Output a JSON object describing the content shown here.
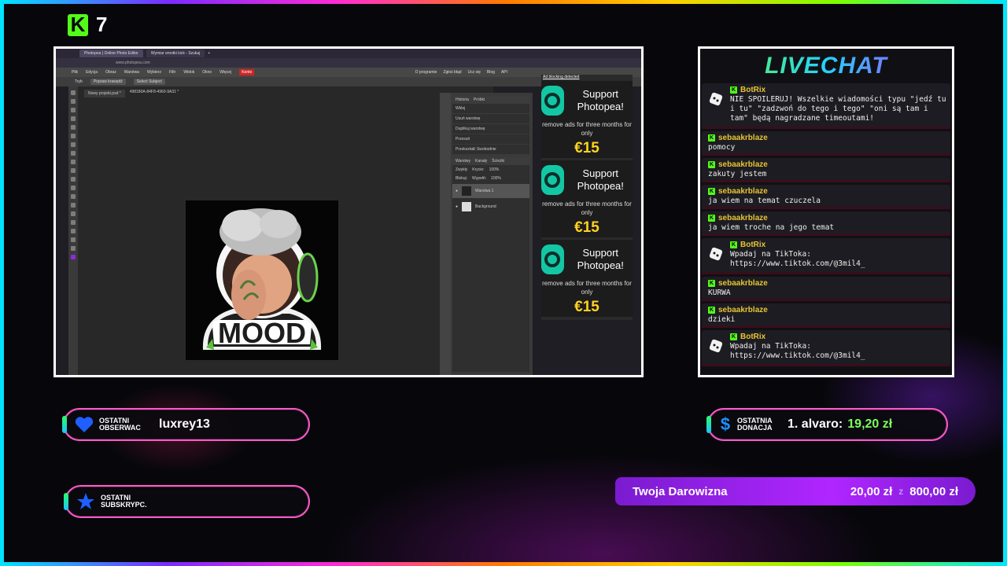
{
  "brand": {
    "number": "7"
  },
  "browser": {
    "tabs": [
      "Photopea | Online Photo Editor",
      "Wymiar emotki kick - Szukaj"
    ],
    "url": "www.photopea.com"
  },
  "photopea": {
    "menu": [
      "Plik",
      "Edycja",
      "Obraz",
      "Warstwa",
      "Wybierz",
      "Filtr",
      "Widok",
      "Okno",
      "Więcej",
      "Konto"
    ],
    "menu_right": [
      "O programie",
      "Zgłoś błąd",
      "Ucz się",
      "Blog",
      "API"
    ],
    "options": {
      "mode_label": "Tryb",
      "refine_label": "Popraw krawędź",
      "select_subject_label": "Select Subject"
    },
    "doc_tabs": [
      "Nowy projekt.psd *",
      "498180A-84F8-4960-9A31 *"
    ],
    "history": {
      "tabs": [
        "Historia",
        "Próbki"
      ],
      "items": [
        "Wklej",
        "Usuń warstwę",
        "Duplikuj warstwę",
        "Przesuń",
        "Przekształć Swobodnie",
        "Przesuń"
      ]
    },
    "layers": {
      "tabs": [
        "Warstwy",
        "Kanały",
        "Ścieżki"
      ],
      "blend": "Zwykły",
      "opacity_label": "Krycie:",
      "opacity": "100%",
      "lock_label": "Blokuj:",
      "fill_label": "Wypełń:",
      "fill": "100%",
      "items": [
        "Warstwa 1",
        "Background"
      ]
    },
    "canvas_text": "MOOD",
    "ad_blocking": "Ad blocking detected",
    "ads": [
      {
        "title": "Support Photopea!",
        "sub": "remove ads for three months for only",
        "price": "€15"
      },
      {
        "title": "Support Photopea!",
        "sub": "remove ads for three months for only",
        "price": "€15"
      },
      {
        "title": "Support Photopea!",
        "sub": "remove ads for three months for only",
        "price": "€15"
      }
    ]
  },
  "chat": {
    "title": "LIVECHAT",
    "messages": [
      {
        "user": "BotRix",
        "bot": true,
        "text": "NIE SPOILERUJ! Wszelkie wiadomości typu \"jedź tu i tu\" \"zadzwoń do tego i tego\" \"oni są tam i tam\" będą nagradzane timeoutami!"
      },
      {
        "user": "sebaakrblaze",
        "bot": false,
        "text": "pomocy"
      },
      {
        "user": "sebaakrblaze",
        "bot": false,
        "text": "zakuty jestem"
      },
      {
        "user": "sebaakrblaze",
        "bot": false,
        "text": "ja wiem na temat czuczela"
      },
      {
        "user": "sebaakrblaze",
        "bot": false,
        "text": "ja wiem troche na jego temat"
      },
      {
        "user": "BotRix",
        "bot": true,
        "text": "Wpadaj na TikToka: https://www.tiktok.com/@3mil4_"
      },
      {
        "user": "sebaakrblaze",
        "bot": false,
        "text": "KURWA"
      },
      {
        "user": "sebaakrblaze",
        "bot": false,
        "text": "dzieki"
      },
      {
        "user": "BotRix",
        "bot": true,
        "text": "Wpadaj na TikToka: https://www.tiktok.com/@3mil4_"
      }
    ]
  },
  "alerts": {
    "follower": {
      "label1": "OSTATNI",
      "label2": "OBSERWAC",
      "value": "luxrey13"
    },
    "subscriber": {
      "label1": "OSTATNI",
      "label2": "SUBSKRYPC.",
      "value": ""
    },
    "donation": {
      "label1": "OSTATNIA",
      "label2": "DONACJA",
      "name": "1. alvaro:",
      "amount": "19,20 zł"
    }
  },
  "goal": {
    "label": "Twoja Darowizna",
    "current": "20,00 zł",
    "separator": "z",
    "target": "800,00 zł"
  },
  "colors": {
    "kick_green": "#53fc18",
    "accent_pink": "#ff59c8",
    "goal_purple": "#b026ff",
    "price_yellow": "#ffd21f"
  }
}
